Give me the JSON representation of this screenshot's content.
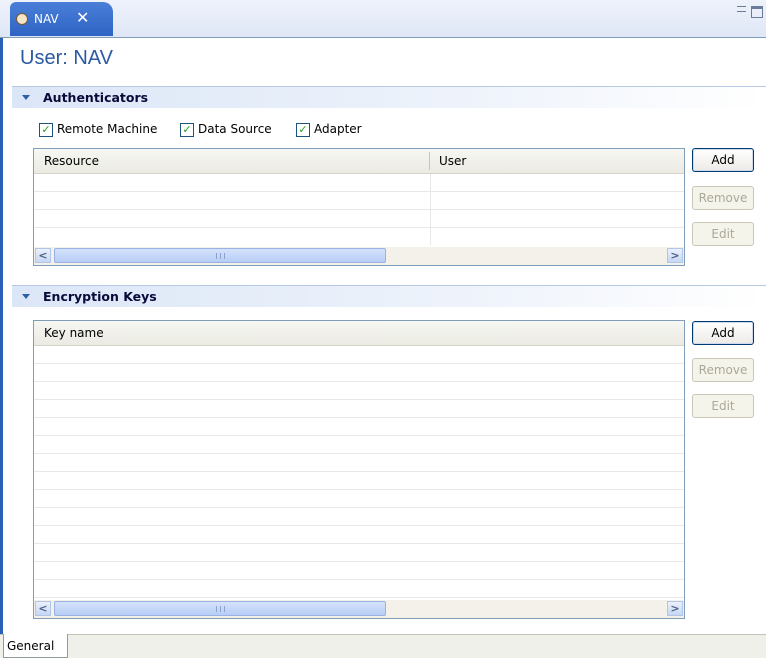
{
  "editor_tab": {
    "label": "NAV",
    "close": "✕"
  },
  "page_title": "User: NAV",
  "authenticators": {
    "title": "Authenticators",
    "checkboxes": [
      {
        "label": "Remote Machine",
        "checked": true
      },
      {
        "label": "Data Source",
        "checked": true
      },
      {
        "label": "Adapter",
        "checked": true
      }
    ],
    "table": {
      "columns": [
        "Resource",
        "User"
      ],
      "rows": []
    },
    "buttons": {
      "add": "Add",
      "remove": "Remove",
      "edit": "Edit"
    }
  },
  "encryption_keys": {
    "title": "Encryption Keys",
    "table": {
      "columns": [
        "Key name"
      ],
      "rows": []
    },
    "buttons": {
      "add": "Add",
      "remove": "Remove",
      "edit": "Edit"
    }
  },
  "bottom_tabs": [
    "General"
  ],
  "icons": {
    "scroll_left": "<",
    "scroll_right": ">",
    "check": "✓"
  },
  "colors": {
    "title": "#2c5aa0",
    "tab_active": "#2e63c4",
    "section_bg": "#dbe6f7"
  }
}
